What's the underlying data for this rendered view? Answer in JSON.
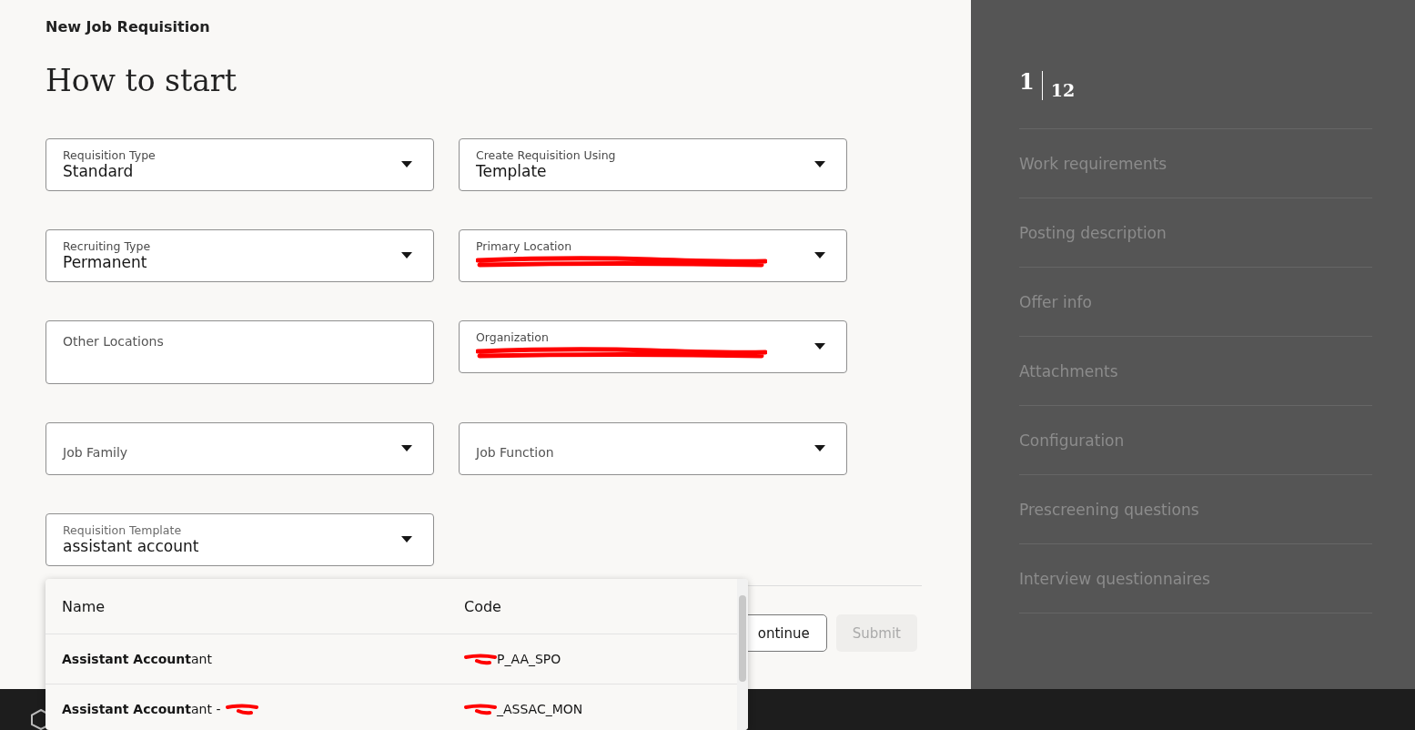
{
  "header": {
    "title": "New Job Requisition",
    "heading": "How to start"
  },
  "fields": [
    {
      "label": "Requisition Type",
      "value": "Standard",
      "kind": "select"
    },
    {
      "label": "Create Requisition Using",
      "value": "Template",
      "kind": "select"
    },
    {
      "label": "Recruiting Type",
      "value": "Permanent",
      "kind": "select"
    },
    {
      "label": "Primary Location",
      "value_redacted": true,
      "kind": "select"
    },
    {
      "label": "Other Locations",
      "kind": "text"
    },
    {
      "label": "Organization",
      "value_redacted": true,
      "kind": "select"
    },
    {
      "label": "Job Family",
      "kind": "select"
    },
    {
      "label": "Job Function",
      "kind": "select"
    },
    {
      "label": "Requisition Template",
      "value": "assistant account",
      "kind": "select"
    }
  ],
  "dropdown": {
    "columns": [
      "Name",
      "Code"
    ],
    "rows": [
      {
        "name": "**Assistant Account**ant",
        "name_redacted": false,
        "code": "P_AA_SPO"
      },
      {
        "name": "**Assistant Account**ant -",
        "name_redacted": true,
        "code": "_ASSAC_MON"
      }
    ]
  },
  "buttons": [
    {
      "label": "ontinue",
      "disabled": false
    },
    {
      "label": "Submit",
      "disabled": true
    }
  ],
  "steps": {
    "current": "1",
    "total": "12",
    "items": [
      "Work requirements",
      "Posting description",
      "Offer info",
      "Attachments",
      "Configuration",
      "Prescreening questions",
      "Interview questionnaires"
    ]
  }
}
